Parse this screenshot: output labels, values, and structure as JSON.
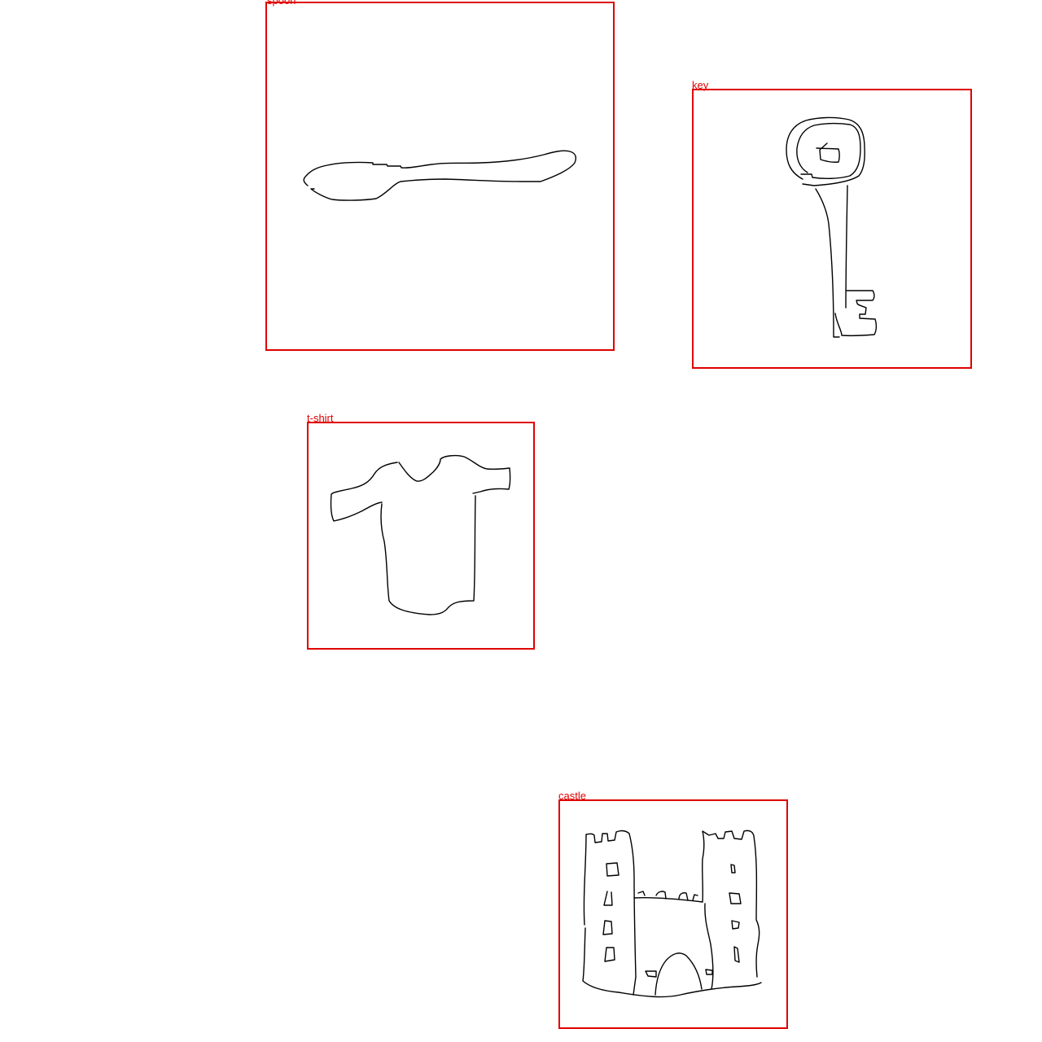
{
  "annotations": [
    {
      "id": "spoon",
      "label": "spoon"
    },
    {
      "id": "key",
      "label": "key"
    },
    {
      "id": "tshirt",
      "label": "t-shirt"
    },
    {
      "id": "castle",
      "label": "castle"
    }
  ],
  "colors": {
    "box": "#e00000",
    "label": "#e00000",
    "stroke": "#000000",
    "background": "#ffffff"
  }
}
